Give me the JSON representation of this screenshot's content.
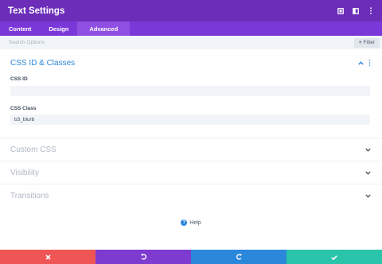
{
  "header": {
    "title": "Text Settings",
    "icons": [
      "expand-icon",
      "split-view-icon",
      "more-vertical-icon"
    ]
  },
  "tabs": [
    {
      "label": "Content",
      "active": false
    },
    {
      "label": "Design",
      "active": false
    },
    {
      "label": "Advanced",
      "active": true
    }
  ],
  "search": {
    "placeholder": "Search Options",
    "filter_label": "Filter"
  },
  "sections": {
    "css": {
      "title": "CSS ID & Classes",
      "expanded": true,
      "css_id_label": "CSS ID",
      "css_id_value": "",
      "css_class_label": "CSS Class",
      "css_class_value": "b3_blurb"
    },
    "custom_css": {
      "title": "Custom CSS",
      "expanded": false
    },
    "visibility": {
      "title": "Visibility",
      "expanded": false
    },
    "transitions": {
      "title": "Transitions",
      "expanded": false
    }
  },
  "help": {
    "label": "Help"
  },
  "footer": {
    "buttons": [
      {
        "name": "cancel",
        "icon": "close-icon",
        "color": "#ef5555"
      },
      {
        "name": "undo",
        "icon": "undo-icon",
        "color": "#7e3bd0"
      },
      {
        "name": "redo",
        "icon": "redo-icon",
        "color": "#2b87da"
      },
      {
        "name": "save",
        "icon": "check-icon",
        "color": "#29c4a9"
      }
    ]
  },
  "colors": {
    "header": "#6c2eb9",
    "tabs": "#7b38d8",
    "accent": "#2b87da"
  }
}
